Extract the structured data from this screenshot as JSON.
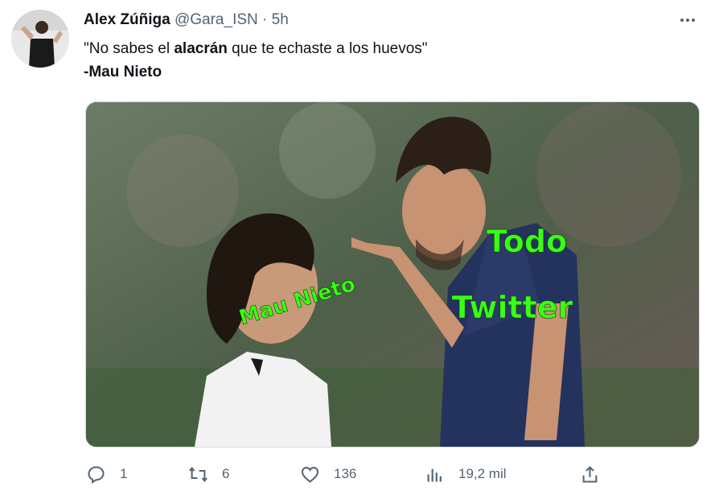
{
  "tweet": {
    "author_name": "Alex Zúñiga",
    "handle": "@Gara_ISN",
    "separator": "·",
    "time": "5h",
    "more_icon": "more-icon",
    "text_part1": "\"No sabes el ",
    "text_bold": "alacrán",
    "text_part2": " que te echaste a los huevos\"",
    "text_line2": "-Mau Nieto"
  },
  "media": {
    "overlay_labels": {
      "left_player": "Mau Nieto",
      "right_top": "Todo",
      "right_bottom": "Twitter"
    },
    "overlay_color": "#39ff14"
  },
  "actions": {
    "reply_count": "1",
    "retweet_count": "6",
    "like_count": "136",
    "views_count": "19,2 mil"
  },
  "colors": {
    "text_primary": "#0f1419",
    "text_secondary": "#536471"
  }
}
